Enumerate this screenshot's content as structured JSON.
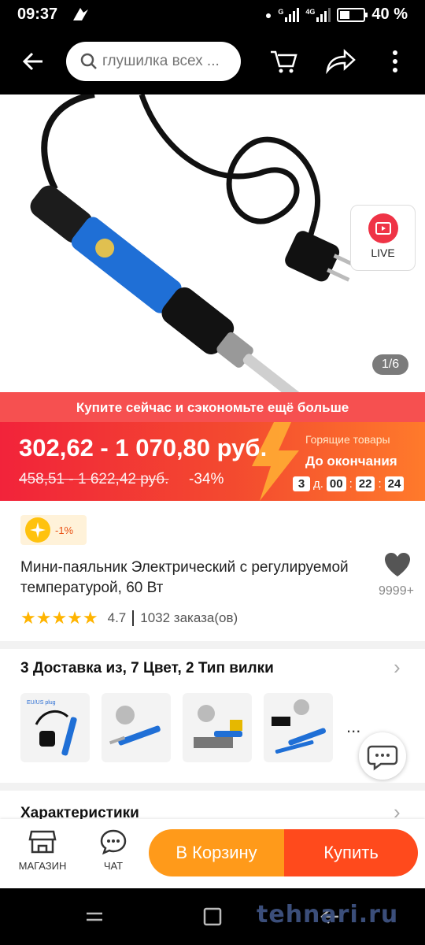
{
  "status": {
    "time": "09:37",
    "battery": "40 %",
    "battery_level": 0.4,
    "net1": "G",
    "net2": "4G"
  },
  "search": {
    "placeholder": "глушилка всех ..."
  },
  "product": {
    "counter": "1/6",
    "live_label": "LIVE"
  },
  "promo": {
    "banner": "Купите сейчас и сэкономьте ещё больше",
    "price": "302,62 - 1 070,80 руб.",
    "old_price": "458,51 - 1 622,42 руб.",
    "discount": "-34%",
    "hot_label": "Горящие товары",
    "until_label": "До окончания",
    "timer": {
      "days": "3",
      "days_unit": "д.",
      "hours": "00",
      "minutes": "22",
      "seconds": "24"
    }
  },
  "info": {
    "coupon": "-1%",
    "title": "Мини-паяльник Электрический с регулируемой температурой, 60 Вт",
    "wishlist_count": "9999+",
    "rating_stars": 5,
    "rating": "4.7",
    "orders": "1032 заказа(ов)"
  },
  "variants": {
    "title": "3 Доставка из, 7 Цвет, 2 Тип вилки",
    "thumb1_label": "EU/US plug",
    "more": "..."
  },
  "spec_title": "Характеристики",
  "bottom": {
    "store": "МАГАЗИН",
    "chat": "ЧАТ",
    "cart": "В Корзину",
    "buy": "Купить"
  },
  "colors": {
    "accent": "#ff4a1c",
    "cart": "#ff9a1a",
    "promo": "#f2233a"
  },
  "watermark": "tehnari.ru"
}
